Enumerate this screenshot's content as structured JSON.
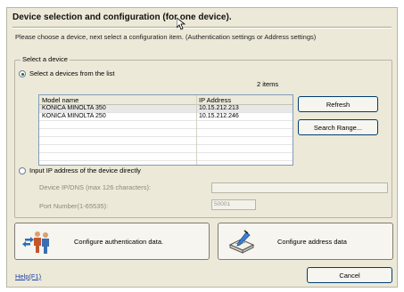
{
  "dialog": {
    "title": "Device selection and configuration (for one device).",
    "instruction": "Please choose a device, next select a configuration item. (Authentication settings or Address settings)"
  },
  "select_device": {
    "legend": "Select a device",
    "option_list_label": "Select a devices from the list",
    "option_list_selected": true,
    "item_count": "2 items",
    "columns": [
      "Model name",
      "IP Address"
    ],
    "devices": [
      {
        "model": "KONICA MINOLTA 350",
        "ip": "10.15.212.213"
      },
      {
        "model": "KONICA MINOLTA 250",
        "ip": "10.15.212.246"
      }
    ],
    "refresh_label": "Refresh",
    "search_label": "Search Range...",
    "option_direct_label": "Input IP address of the device directly",
    "ip_field_label": "Device IP/DNS (max 126 characters):",
    "ip_field_value": "",
    "port_field_label": "Port Number(1-65535):",
    "port_field_value": "50001"
  },
  "actions": {
    "auth_label": "Configure authentication data.",
    "address_label": "Configure address data"
  },
  "footer": {
    "help_label": "Help(F1)",
    "cancel_label": "Cancel"
  },
  "icons": {
    "auth": "people-key-icon",
    "address": "address-book-pen-icon"
  }
}
